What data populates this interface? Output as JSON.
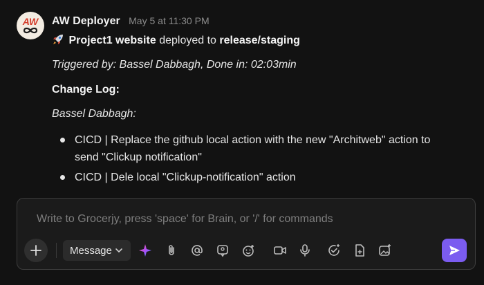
{
  "message": {
    "sender": "AW Deployer",
    "timestamp": "May 5 at 11:30 PM",
    "avatar_text": "AW",
    "project": "Project1 website",
    "deployed_to_text": "deployed to",
    "branch": "release/staging",
    "triggered": "Triggered by: Bassel Dabbagh, Done in: 02:03min",
    "changelog_title": "Change Log:",
    "author": "Bassel Dabbagh:",
    "items": [
      "CICD | Replace the github local action with the new \"Architweb\" action to send \"Clickup notification\"",
      "CICD | Dele local \"Clickup-notification\" action"
    ]
  },
  "composer": {
    "placeholder": "Write to Grocerjy, press 'space' for Brain, or '/' for commands",
    "mode_label": "Message",
    "tools": [
      "ai-sparkle-icon",
      "attachment-icon",
      "mention-icon",
      "clip-icon",
      "emoji-icon",
      "video-icon",
      "microphone-icon",
      "task-icon",
      "doc-icon",
      "image-icon"
    ]
  },
  "colors": {
    "send": "#7b5cf0",
    "background": "#121212"
  }
}
